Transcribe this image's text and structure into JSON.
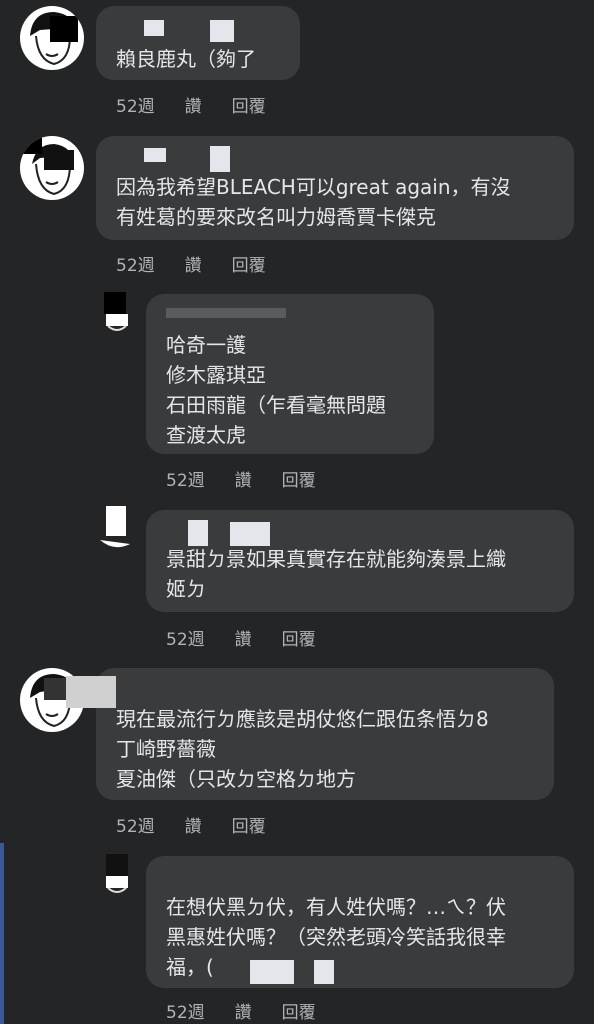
{
  "comments": [
    {
      "text": "賴良鹿丸（夠了",
      "time": "52週",
      "like": "讚",
      "reply": "回覆"
    },
    {
      "text": "因為我希望BLEACH可以great again，有沒\n有姓葛的要來改名叫力姆喬賈卡傑克",
      "time": "52週",
      "like": "讚",
      "reply": "回覆"
    },
    {
      "text": "哈奇一護\n修木露琪亞\n石田雨龍（乍看毫無問題\n查渡太虎",
      "time": "52週",
      "like": "讚",
      "reply": "回覆"
    },
    {
      "text": "景甜ㄉ景如果真實存在就能夠湊景上織\n姬ㄉ",
      "time": "52週",
      "like": "讚",
      "reply": "回覆"
    },
    {
      "text": "現在最流行ㄉ應該是胡仗悠仁跟伍条悟ㄉ8\n丁崎野薔薇\n夏油傑（只改ㄉ空格ㄉ地方",
      "time": "52週",
      "like": "讚",
      "reply": "回覆"
    },
    {
      "text": "在想伏黑ㄉ伏，有人姓伏嗎？…ㄟ？伏\n黑惠姓伏嗎？（突然老頭冷笑話我很幸\n福，(",
      "time": "52週",
      "like": "讚",
      "reply": "回覆"
    }
  ]
}
